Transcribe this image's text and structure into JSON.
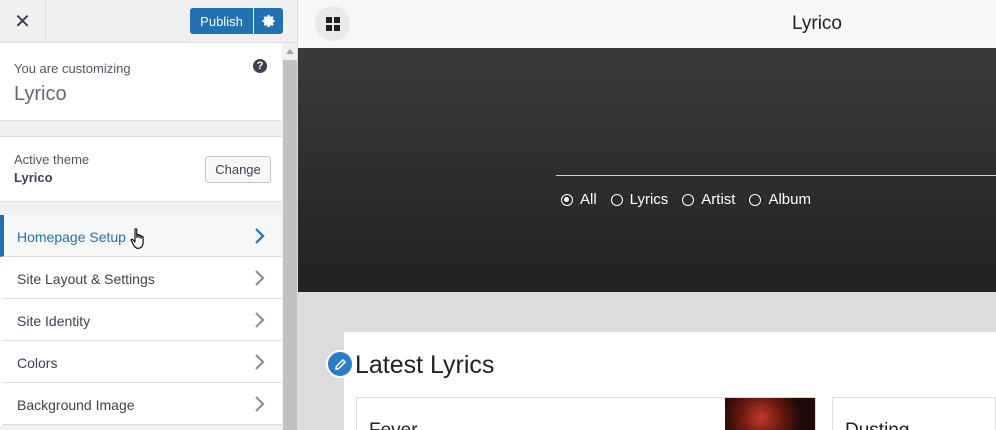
{
  "topbar": {
    "close_glyph": "✕",
    "publish_label": "Publish"
  },
  "customizing": {
    "label": "You are customizing",
    "site": "Lyrico",
    "help_glyph": "?"
  },
  "theme": {
    "label": "Active theme",
    "name": "Lyrico",
    "change_label": "Change"
  },
  "menu": {
    "items": [
      {
        "label": "Homepage Setup",
        "active": true
      },
      {
        "label": "Site Layout & Settings",
        "active": false
      },
      {
        "label": "Site Identity",
        "active": false
      },
      {
        "label": "Colors",
        "active": false
      },
      {
        "label": "Background Image",
        "active": false
      }
    ]
  },
  "preview": {
    "site_title": "Lyrico",
    "search_filters": [
      {
        "label": "All",
        "checked": true
      },
      {
        "label": "Lyrics",
        "checked": false
      },
      {
        "label": "Artist",
        "checked": false
      },
      {
        "label": "Album",
        "checked": false
      }
    ],
    "section_title": "Latest Lyrics",
    "cards": [
      {
        "title": "Fever"
      },
      {
        "title": "Dusting"
      }
    ]
  },
  "colors": {
    "accent": "#2271b1",
    "hero_dark": "#2b2b2b"
  }
}
